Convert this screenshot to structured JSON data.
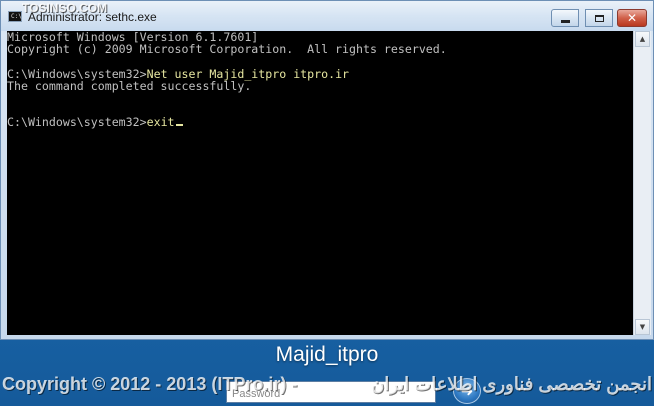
{
  "window": {
    "title": "Administrator: sethc.exe",
    "icon": "console-icon",
    "icon_text": "C:\\",
    "controls": {
      "minimize": "minimize-icon",
      "maximize": "maximize-icon",
      "close": "close-icon",
      "close_glyph": "✕"
    }
  },
  "console": {
    "lines": [
      {
        "text": "Microsoft Windows [Version 6.1.7601]",
        "style": "plain"
      },
      {
        "text": "Copyright (c) 2009 Microsoft Corporation.  All rights reserved.",
        "style": "plain"
      },
      {
        "text": "",
        "style": "plain"
      },
      {
        "prompt": "C:\\Windows\\system32>",
        "command": "Net user Majid_itpro itpro.ir"
      },
      {
        "text": "The command completed successfully.",
        "style": "plain"
      },
      {
        "text": "",
        "style": "plain"
      },
      {
        "text": "",
        "style": "plain"
      },
      {
        "prompt": "C:\\Windows\\system32>",
        "command": "exit",
        "cursor": true
      }
    ],
    "colors": {
      "background": "#000000",
      "text": "#c0c0c0",
      "command": "#e6e6a0"
    }
  },
  "logon": {
    "username": "Majid_itpro",
    "password_placeholder": "Password",
    "go_icon": "arrow-right-icon",
    "go_glyph": "➜"
  },
  "watermark": {
    "left": "Copyright © 2012 - 2013 (ITPro.ir) -",
    "right": "انجمن تخصصی فناوری اطلاعات ایران",
    "site": "TOSINSO.COM"
  }
}
